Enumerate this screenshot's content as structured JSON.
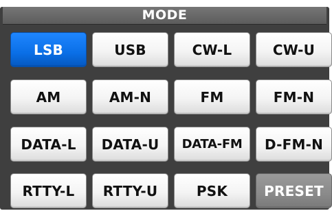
{
  "title": "MODE",
  "selected_mode": "LSB",
  "buttons": {
    "lsb": "LSB",
    "usb": "USB",
    "cw_l": "CW-L",
    "cw_u": "CW-U",
    "am": "AM",
    "am_n": "AM-N",
    "fm": "FM",
    "fm_n": "FM-N",
    "data_l": "DATA-L",
    "data_u": "DATA-U",
    "data_fm": "DATA-FM",
    "d_fm_n": "D-FM-N",
    "rtty_l": "RTTY-L",
    "rtty_u": "RTTY-U",
    "psk": "PSK",
    "preset": "PRESET"
  },
  "colors": {
    "selected": "#0a6fe6",
    "panel": "#3f3f3f",
    "title_bar": "#666666",
    "preset": "#8a8a8a"
  }
}
